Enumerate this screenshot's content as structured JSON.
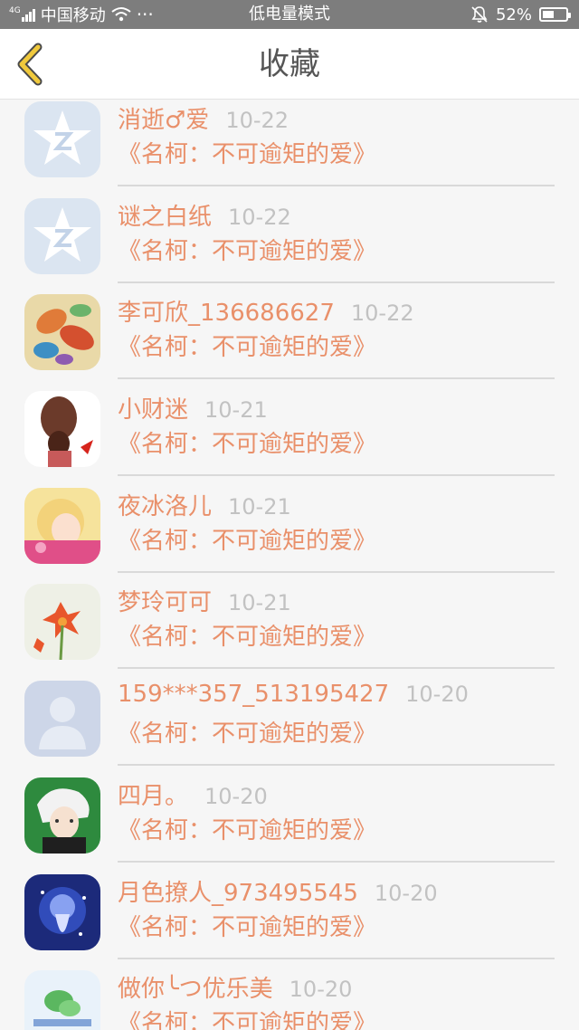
{
  "status_bar": {
    "carrier": "中国移动",
    "signal_label": "4G",
    "dots": "···",
    "mode": "低电量模式",
    "battery_percent": "52%",
    "battery_level": 0.52
  },
  "nav": {
    "title": "收藏"
  },
  "colors": {
    "accent": "#e9906a",
    "back_arrow": "#f0c93c",
    "date": "#c2c2c2"
  },
  "favorites": [
    {
      "user": "消逝♂爱",
      "date": "10-22",
      "title": "《名柯：不可逾矩的爱》",
      "avatar": "qq-default-avatar"
    },
    {
      "user": "谜之白纸",
      "date": "10-22",
      "title": "《名柯：不可逾矩的爱》",
      "avatar": "qq-default-avatar"
    },
    {
      "user": "李可欣_136686627",
      "date": "10-22",
      "title": "《名柯：不可逾矩的爱》",
      "avatar": "butterfly-avatar"
    },
    {
      "user": "小财迷",
      "date": "10-21",
      "title": "《名柯：不可逾矩的爱》",
      "avatar": "girl-hair-avatar"
    },
    {
      "user": "夜冰洛儿",
      "date": "10-21",
      "title": "《名柯：不可逾矩的爱》",
      "avatar": "anime-girl-avatar"
    },
    {
      "user": "梦玲可可",
      "date": "10-21",
      "title": "《名柯：不可逾矩的爱》",
      "avatar": "lily-flower-avatar"
    },
    {
      "user": "159***357_513195427",
      "date": "10-20",
      "title": "《名柯：不可逾矩的爱》",
      "avatar": "default-person-avatar"
    },
    {
      "user": "四月。",
      "date": "10-20",
      "title": "《名柯：不可逾矩的爱》",
      "avatar": "anime-boy-avatar"
    },
    {
      "user": "月色撩人_973495545",
      "date": "10-20",
      "title": "《名柯：不可逾矩的爱》",
      "avatar": "moonlight-avatar"
    },
    {
      "user": "做你╰つ优乐美",
      "date": "10-20",
      "title": "《名柯：不可逾矩的爱》",
      "avatar": "wechat-ad-avatar"
    }
  ]
}
